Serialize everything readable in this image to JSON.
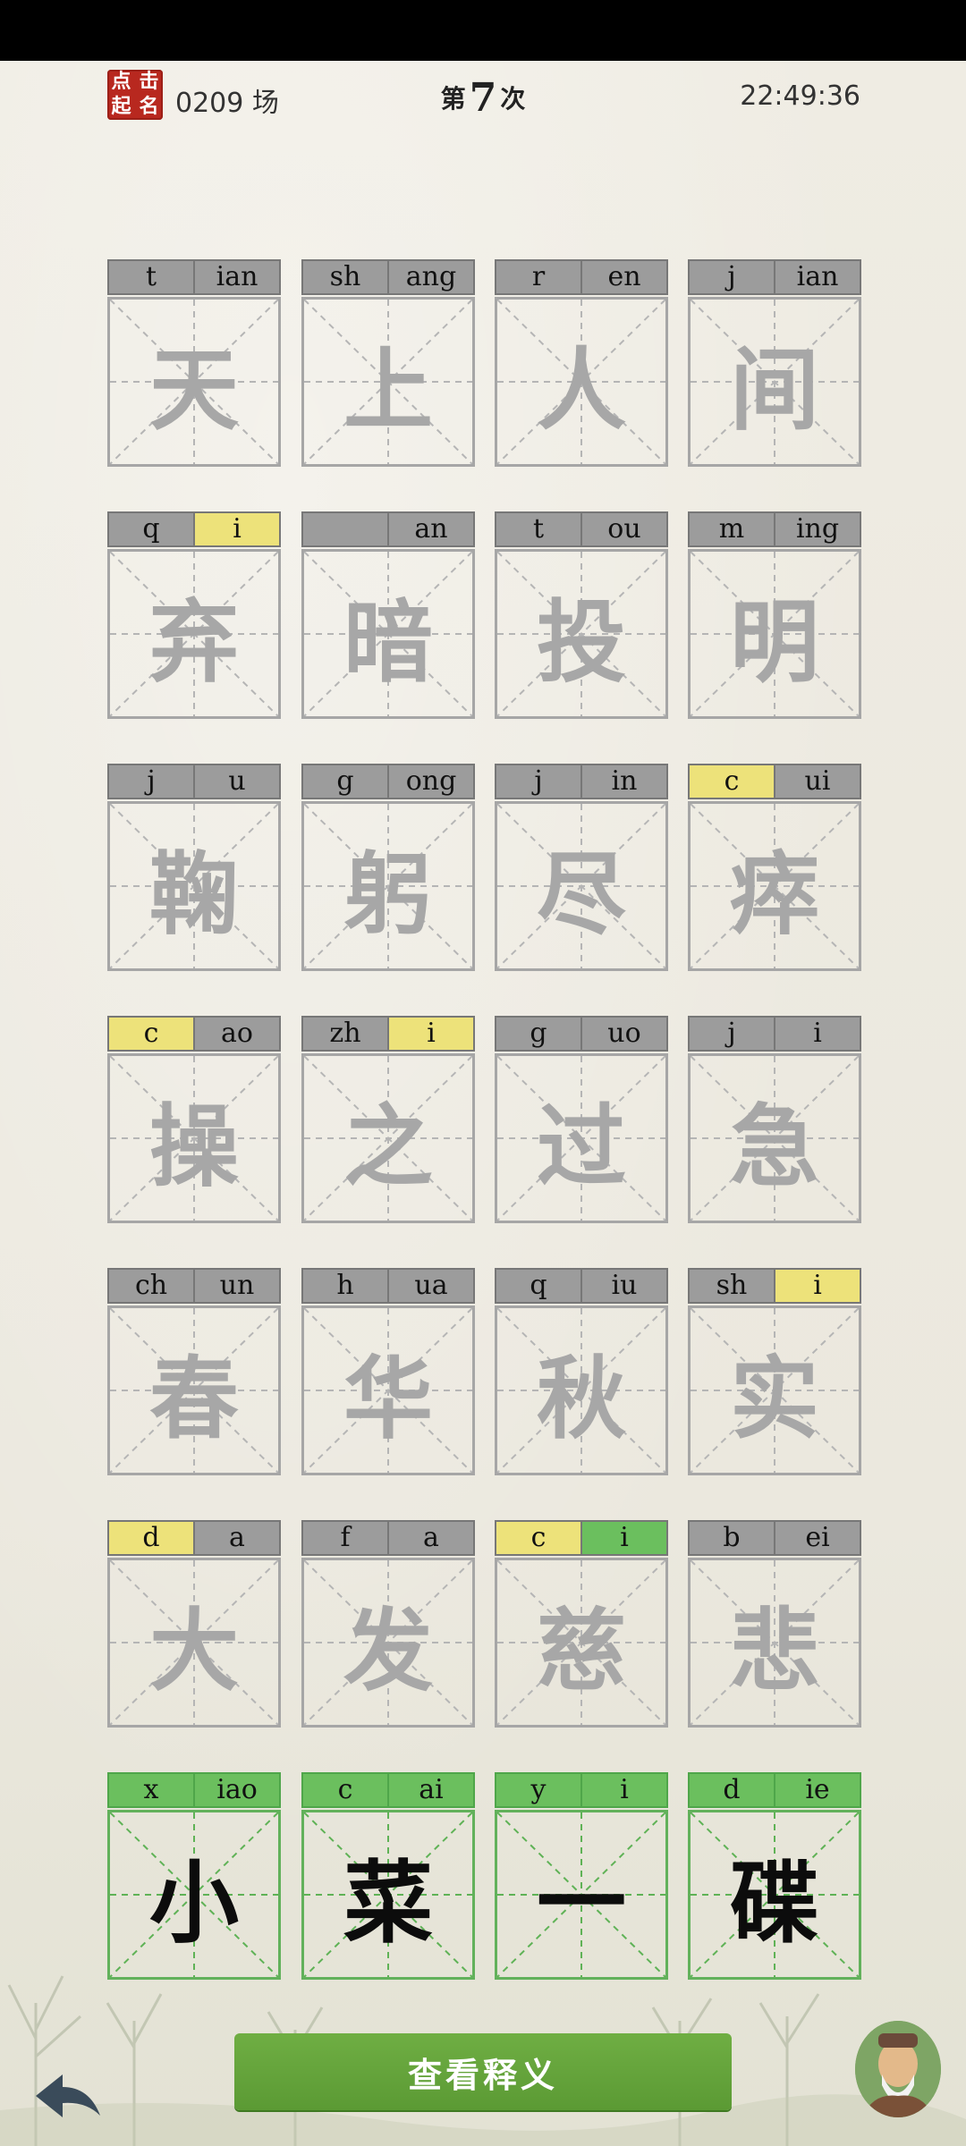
{
  "header": {
    "seal_chars": [
      "点",
      "击",
      "起",
      "名"
    ],
    "game_number": "0209 场",
    "attempt_prefix": "第",
    "attempt_number": "7",
    "attempt_suffix": "次",
    "time": "22:49:36"
  },
  "colors": {
    "hint_gray": "#9c9c9c",
    "hint_yellow": "#ede27a",
    "hint_green": "#6bbf5e",
    "button_green": "#5b9a34",
    "seal_red": "#b8281f"
  },
  "rows": [
    {
      "solved": false,
      "cells": [
        {
          "initial": "t",
          "initial_state": "gray",
          "final": "ian",
          "final_state": "gray",
          "char": "天"
        },
        {
          "initial": "sh",
          "initial_state": "gray",
          "final": "ang",
          "final_state": "gray",
          "char": "上"
        },
        {
          "initial": "r",
          "initial_state": "gray",
          "final": "en",
          "final_state": "gray",
          "char": "人"
        },
        {
          "initial": "j",
          "initial_state": "gray",
          "final": "ian",
          "final_state": "gray",
          "char": "间"
        }
      ]
    },
    {
      "solved": false,
      "cells": [
        {
          "initial": "q",
          "initial_state": "gray",
          "final": "i",
          "final_state": "yellow",
          "char": "弃"
        },
        {
          "initial": "",
          "initial_state": "gray",
          "final": "an",
          "final_state": "gray",
          "char": "暗"
        },
        {
          "initial": "t",
          "initial_state": "gray",
          "final": "ou",
          "final_state": "gray",
          "char": "投"
        },
        {
          "initial": "m",
          "initial_state": "gray",
          "final": "ing",
          "final_state": "gray",
          "char": "明"
        }
      ]
    },
    {
      "solved": false,
      "cells": [
        {
          "initial": "j",
          "initial_state": "gray",
          "final": "u",
          "final_state": "gray",
          "char": "鞠"
        },
        {
          "initial": "g",
          "initial_state": "gray",
          "final": "ong",
          "final_state": "gray",
          "char": "躬"
        },
        {
          "initial": "j",
          "initial_state": "gray",
          "final": "in",
          "final_state": "gray",
          "char": "尽"
        },
        {
          "initial": "c",
          "initial_state": "yellow",
          "final": "ui",
          "final_state": "gray",
          "char": "瘁"
        }
      ]
    },
    {
      "solved": false,
      "cells": [
        {
          "initial": "c",
          "initial_state": "yellow",
          "final": "ao",
          "final_state": "gray",
          "char": "操"
        },
        {
          "initial": "zh",
          "initial_state": "gray",
          "final": "i",
          "final_state": "yellow",
          "char": "之"
        },
        {
          "initial": "g",
          "initial_state": "gray",
          "final": "uo",
          "final_state": "gray",
          "char": "过"
        },
        {
          "initial": "j",
          "initial_state": "gray",
          "final": "i",
          "final_state": "gray",
          "char": "急"
        }
      ]
    },
    {
      "solved": false,
      "cells": [
        {
          "initial": "ch",
          "initial_state": "gray",
          "final": "un",
          "final_state": "gray",
          "char": "春"
        },
        {
          "initial": "h",
          "initial_state": "gray",
          "final": "ua",
          "final_state": "gray",
          "char": "华"
        },
        {
          "initial": "q",
          "initial_state": "gray",
          "final": "iu",
          "final_state": "gray",
          "char": "秋"
        },
        {
          "initial": "sh",
          "initial_state": "gray",
          "final": "i",
          "final_state": "yellow",
          "char": "实"
        }
      ]
    },
    {
      "solved": false,
      "cells": [
        {
          "initial": "d",
          "initial_state": "yellow",
          "final": "a",
          "final_state": "gray",
          "char": "大"
        },
        {
          "initial": "f",
          "initial_state": "gray",
          "final": "a",
          "final_state": "gray",
          "char": "发"
        },
        {
          "initial": "c",
          "initial_state": "yellow",
          "final": "i",
          "final_state": "green",
          "char": "慈"
        },
        {
          "initial": "b",
          "initial_state": "gray",
          "final": "ei",
          "final_state": "gray",
          "char": "悲"
        }
      ]
    },
    {
      "solved": true,
      "cells": [
        {
          "initial": "x",
          "initial_state": "green",
          "final": "iao",
          "final_state": "green",
          "char": "小"
        },
        {
          "initial": "c",
          "initial_state": "green",
          "final": "ai",
          "final_state": "green",
          "char": "菜"
        },
        {
          "initial": "y",
          "initial_state": "green",
          "final": "i",
          "final_state": "green",
          "char": "一"
        },
        {
          "initial": "d",
          "initial_state": "green",
          "final": "ie",
          "final_state": "green",
          "char": "碟"
        }
      ]
    }
  ],
  "footer": {
    "explain_button": "查看释义",
    "back_icon": "back-arrow-icon",
    "avatar_icon": "scholar-avatar-icon"
  }
}
